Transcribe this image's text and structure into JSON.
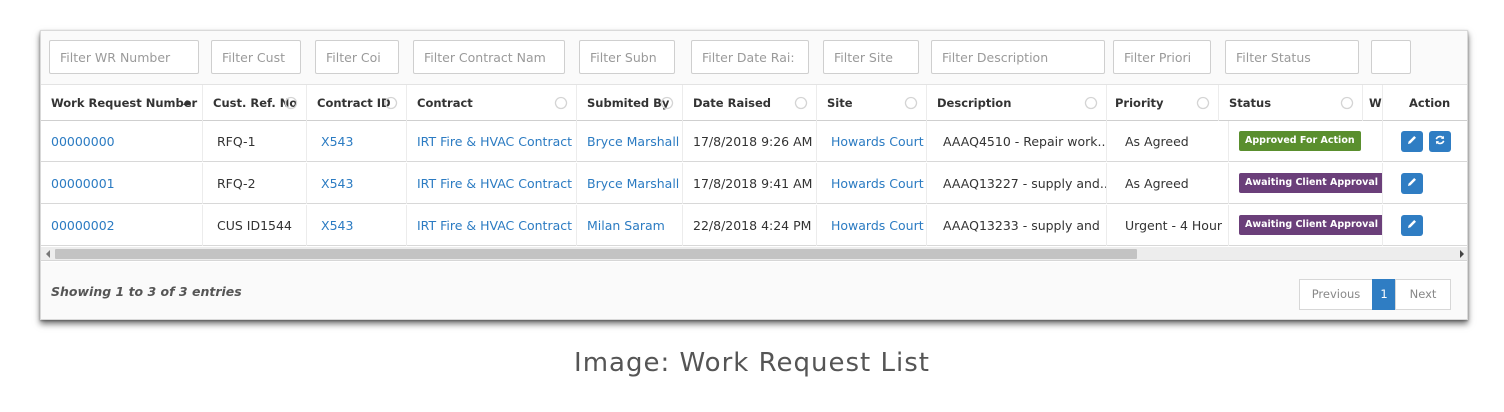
{
  "filters": [
    {
      "placeholder": "Filter WR Number"
    },
    {
      "placeholder": "Filter Cust"
    },
    {
      "placeholder": "Filter Coi"
    },
    {
      "placeholder": "Filter Contract Nam"
    },
    {
      "placeholder": "Filter Subn"
    },
    {
      "placeholder": "Filter Date Rai:"
    },
    {
      "placeholder": "Filter Site"
    },
    {
      "placeholder": "Filter Description"
    },
    {
      "placeholder": "Filter Priori"
    },
    {
      "placeholder": "Filter Status"
    },
    {
      "placeholder": ""
    }
  ],
  "columns": [
    {
      "label": "Work Request Number",
      "sort": "asc"
    },
    {
      "label": "Cust. Ref. No",
      "sort": "none"
    },
    {
      "label": "Contract ID",
      "sort": "none"
    },
    {
      "label": "Contract",
      "sort": "none"
    },
    {
      "label": "Submited By",
      "sort": "none"
    },
    {
      "label": "Date Raised",
      "sort": "none"
    },
    {
      "label": "Site",
      "sort": "none"
    },
    {
      "label": "Description",
      "sort": "none"
    },
    {
      "label": "Priority",
      "sort": "none"
    },
    {
      "label": "Status",
      "sort": "none"
    },
    {
      "label": "W",
      "sort": "none"
    },
    {
      "label": "Action",
      "sort": "none"
    }
  ],
  "rows": [
    {
      "wr_number": "00000000",
      "cust_ref": "RFQ-1",
      "contract_id": "X543",
      "contract": "IRT Fire & HVAC Contract",
      "submitted_by": "Bryce Marshall",
      "date_raised": "17/8/2018 9:26 AM",
      "site": "Howards Court",
      "description": "AAAQ4510 - Repair work...",
      "priority": "As Agreed",
      "status": "Approved For Action",
      "status_color": "#5a8f2e",
      "actions": [
        "edit-icon",
        "refresh-icon"
      ]
    },
    {
      "wr_number": "00000001",
      "cust_ref": "RFQ-2",
      "contract_id": "X543",
      "contract": "IRT Fire & HVAC Contract",
      "submitted_by": "Bryce Marshall",
      "date_raised": "17/8/2018 9:41 AM",
      "site": "Howards Court",
      "description": "AAAQ13227 - supply and...",
      "priority": "As Agreed",
      "status": "Awaiting Client Approval",
      "status_color": "#6b3f7a",
      "actions": [
        "edit-icon"
      ]
    },
    {
      "wr_number": "00000002",
      "cust_ref": "CUS ID1544",
      "contract_id": "X543",
      "contract": "IRT Fire & HVAC Contract",
      "submitted_by": "Milan Saram",
      "date_raised": "22/8/2018 4:24 PM",
      "site": "Howards Court",
      "description": "AAAQ13233 - supply and",
      "priority": "Urgent - 4 Hour",
      "status": "Awaiting Client Approval",
      "status_color": "#6b3f7a",
      "actions": [
        "edit-icon"
      ]
    }
  ],
  "footer": {
    "info": "Showing 1 to 3 of 3 entries",
    "previous_label": "Previous",
    "current_page": "1",
    "next_label": "Next"
  },
  "caption": "Image: Work Request List",
  "colors": {
    "link": "#2b7bc2",
    "primary_button": "#2f7dc3",
    "approved_badge": "#5a8f2e",
    "awaiting_badge": "#6b3f7a"
  }
}
